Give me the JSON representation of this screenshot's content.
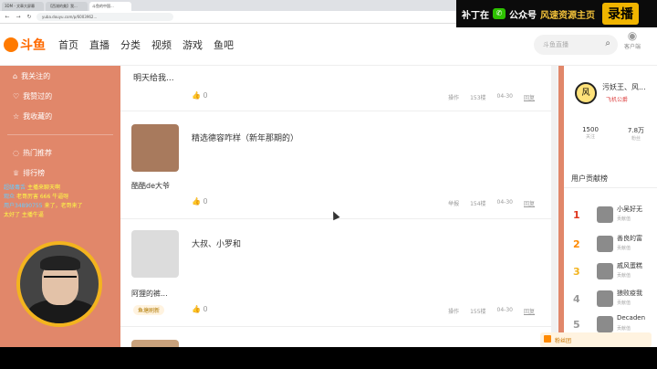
{
  "browser": {
    "tabs": [
      "3DM - 文章大屏幕",
      "【西湖的美】我...",
      "斗鱼的中国..."
    ],
    "url": "yuba.douyu.com/p/6003962..."
  },
  "banner": {
    "prefix": "补丁在",
    "middle": "公众号",
    "highlight": "风速资源主页",
    "rec_label": "录播"
  },
  "header": {
    "logo_text": "斗鱼",
    "nav": [
      "首页",
      "直播",
      "分类",
      "视频",
      "游戏",
      "鱼吧"
    ],
    "search_placeholder": "斗鱼直播",
    "user_label": "客户端"
  },
  "sidebar": {
    "items": [
      "我关注的",
      "我赞过的",
      "我收藏的",
      "热门推荐",
      "排行榜"
    ]
  },
  "posts": [
    {
      "text": "明天给我...",
      "likes": "0",
      "action": "操作",
      "floor": "153楼",
      "date": "04-30",
      "reply": "回复"
    },
    {
      "text": "精选德容咋样（新年那期的）",
      "author": "酷酷de大爷",
      "likes": "0",
      "action": "举报",
      "floor": "154楼",
      "date": "04-30",
      "reply": "回复"
    },
    {
      "text": "大叔、小罗和",
      "author": "阿狸的裤...",
      "badge": "鱼塘刷新",
      "likes": "0",
      "action": "操作",
      "floor": "155楼",
      "date": "04-30",
      "reply": "回复"
    }
  ],
  "right_panel": {
    "name": "污妖王、风...",
    "tag": "飞机公爵",
    "stats": [
      {
        "value": "1500",
        "label": "关注"
      },
      {
        "value": "7.8万",
        "label": "粉丝"
      }
    ],
    "section_title": "用户贡献榜",
    "ranks": [
      {
        "num": "1",
        "name": "小吴好无",
        "sub": "贡献值"
      },
      {
        "num": "2",
        "name": "善良的富",
        "sub": "贡献值"
      },
      {
        "num": "3",
        "name": "戚风蛋糕",
        "sub": "贡献值"
      },
      {
        "num": "4",
        "name": "狼败疫我",
        "sub": "贡献值"
      },
      {
        "num": "5",
        "name": "Decaden",
        "sub": "贡献值"
      }
    ],
    "fans_button": "粉丝团"
  },
  "chat": [
    {
      "name": "超级毒舌",
      "msg": "主播来聊天啊"
    },
    {
      "name": "观众",
      "msg": "老哥厉害 666 牛逼呀"
    },
    {
      "name": "用户34890755",
      "msg": "来了，老哥来了"
    },
    {
      "name": "",
      "msg": "太好了 主播牛逼"
    }
  ],
  "colors": {
    "accent": "#e1876a",
    "brand": "#ff6a00",
    "rank1": "#e0371f",
    "rank2": "#ff8a00",
    "rank3": "#f3b41f"
  }
}
